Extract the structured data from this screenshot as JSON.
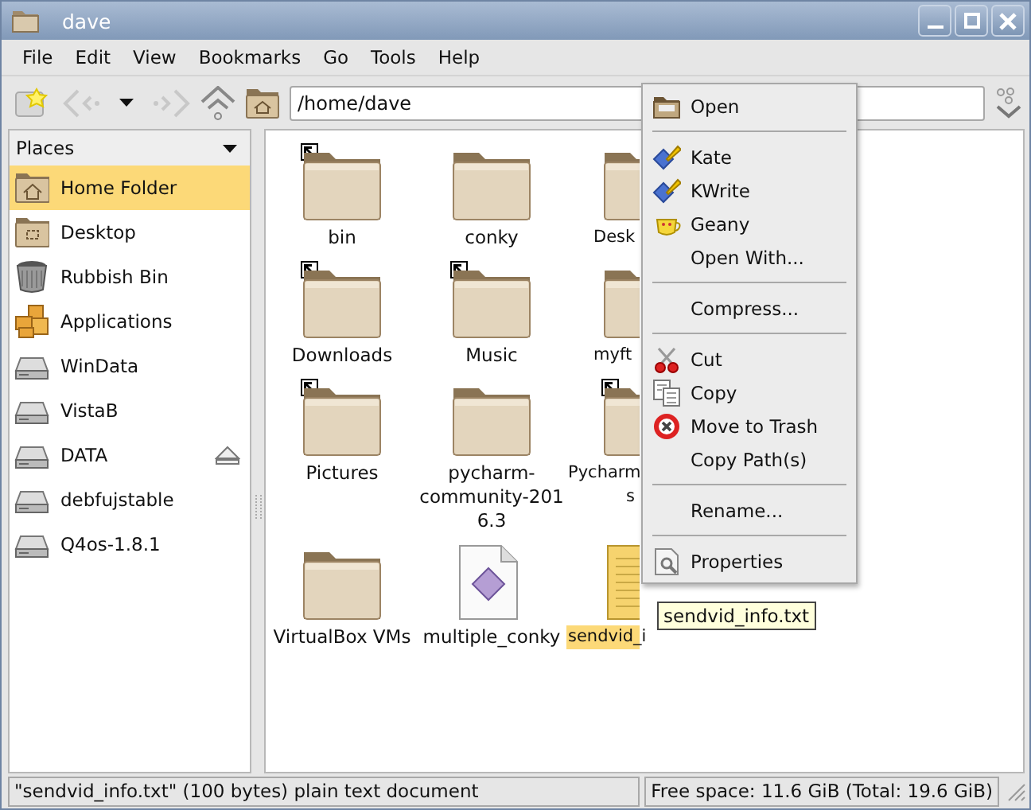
{
  "window": {
    "title": "dave"
  },
  "menu_bar": [
    {
      "label": "File"
    },
    {
      "label": "Edit"
    },
    {
      "label": "View"
    },
    {
      "label": "Bookmarks"
    },
    {
      "label": "Go"
    },
    {
      "label": "Tools"
    },
    {
      "label": "Help"
    }
  ],
  "toolbar": {
    "back_disabled": true,
    "forward_disabled": true,
    "path": "/home/dave"
  },
  "sidebar": {
    "title": "Places",
    "items": [
      {
        "label": "Home Folder",
        "kind": "home",
        "selected": true,
        "eject": false
      },
      {
        "label": "Desktop",
        "kind": "desktop",
        "selected": false,
        "eject": false
      },
      {
        "label": "Rubbish Bin",
        "kind": "trash",
        "selected": false,
        "eject": false
      },
      {
        "label": "Applications",
        "kind": "apps",
        "selected": false,
        "eject": false
      },
      {
        "label": "WinData",
        "kind": "drive",
        "selected": false,
        "eject": false
      },
      {
        "label": "VistaB",
        "kind": "drive",
        "selected": false,
        "eject": false
      },
      {
        "label": "DATA",
        "kind": "drive",
        "selected": false,
        "eject": true
      },
      {
        "label": "debfujstable",
        "kind": "drive",
        "selected": false,
        "eject": false
      },
      {
        "label": "Q4os-1.8.1",
        "kind": "drive",
        "selected": false,
        "eject": false
      }
    ]
  },
  "files": [
    {
      "lines": [
        "bin"
      ],
      "kind": "folder",
      "link": true,
      "selected": false
    },
    {
      "lines": [
        "conky"
      ],
      "kind": "folder",
      "link": false,
      "selected": false
    },
    {
      "lines": [
        "Desk"
      ],
      "kind": "folder",
      "link": false,
      "selected": false
    },
    {
      "lines": [
        "Downloads"
      ],
      "kind": "folder",
      "link": true,
      "selected": false
    },
    {
      "lines": [
        "Music"
      ],
      "kind": "folder",
      "link": true,
      "selected": false
    },
    {
      "lines": [
        "myft"
      ],
      "kind": "folder",
      "link": false,
      "selected": false
    },
    {
      "lines": [
        "Pictures"
      ],
      "kind": "folder",
      "link": true,
      "selected": false
    },
    {
      "lines": [
        "pycharm-",
        "community-201",
        "6.3"
      ],
      "kind": "folder",
      "link": false,
      "selected": false
    },
    {
      "lines": [
        "Pycharm",
        "s"
      ],
      "kind": "folder",
      "link": true,
      "selected": false
    },
    {
      "lines": [
        "VirtualBox VMs"
      ],
      "kind": "folder",
      "link": false,
      "selected": false
    },
    {
      "lines": [
        "multiple_conky"
      ],
      "kind": "script",
      "link": false,
      "selected": false
    },
    {
      "lines": [
        "sendvid_i"
      ],
      "kind": "text",
      "link": false,
      "selected": true
    }
  ],
  "context_menu": [
    {
      "kind": "item",
      "label": "Open"
    },
    {
      "kind": "separator"
    },
    {
      "kind": "item",
      "label": "Kate"
    },
    {
      "kind": "item",
      "label": "KWrite"
    },
    {
      "kind": "item",
      "label": "Geany"
    },
    {
      "kind": "item",
      "label": "Open With..."
    },
    {
      "kind": "separator"
    },
    {
      "kind": "item",
      "label": "Compress..."
    },
    {
      "kind": "separator"
    },
    {
      "kind": "item",
      "label": "Cut"
    },
    {
      "kind": "item",
      "label": "Copy"
    },
    {
      "kind": "item",
      "label": "Move to Trash"
    },
    {
      "kind": "item",
      "label": "Copy Path(s)"
    },
    {
      "kind": "separator"
    },
    {
      "kind": "item",
      "label": "Rename..."
    },
    {
      "kind": "separator"
    },
    {
      "kind": "item",
      "label": "Properties"
    }
  ],
  "tooltip": "sendvid_info.txt",
  "status_bar": {
    "message": "\"sendvid_info.txt\" (100 bytes) plain text document",
    "free_space": "Free space: 11.6 GiB (Total: 19.6 GiB)"
  }
}
